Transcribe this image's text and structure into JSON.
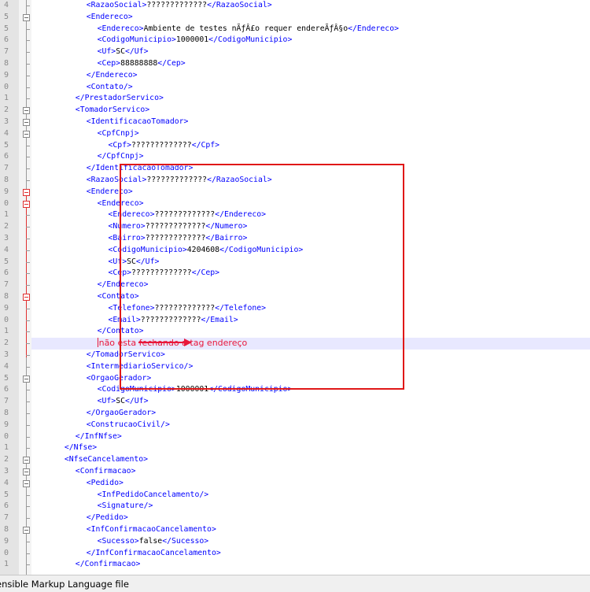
{
  "editor": {
    "line_numbers": [
      "4",
      "5",
      "5",
      "6",
      "7",
      "8",
      "9",
      "0",
      "1",
      "2",
      "3",
      "4",
      "5",
      "6",
      "7",
      "8",
      "9",
      "0",
      "1",
      "2",
      "3",
      "4",
      "5",
      "6",
      "7",
      "8",
      "9",
      "0",
      "1",
      "2",
      "3",
      "4",
      "5",
      "6",
      "7",
      "8",
      "9",
      "0",
      "1",
      "2",
      "3",
      "4",
      "5",
      "6",
      "7",
      "8",
      "9",
      "0",
      "1"
    ],
    "lines": [
      {
        "indent": 6,
        "tokens": [
          {
            "t": "<RazaoSocial>",
            "c": "t"
          },
          {
            "t": "?????????????",
            "c": "x"
          },
          {
            "t": "</RazaoSocial>",
            "c": "t"
          }
        ]
      },
      {
        "indent": 6,
        "tokens": [
          {
            "t": "<Endereco>",
            "c": "t"
          }
        ]
      },
      {
        "indent": 8,
        "tokens": [
          {
            "t": "<Endereco>",
            "c": "t"
          },
          {
            "t": "Ambiente de testes nÃƒÂ£o requer endereÃƒÂ§o",
            "c": "x"
          },
          {
            "t": "</Endereco>",
            "c": "t"
          }
        ]
      },
      {
        "indent": 8,
        "tokens": [
          {
            "t": "<CodigoMunicipio>",
            "c": "t"
          },
          {
            "t": "1000001",
            "c": "x"
          },
          {
            "t": "</CodigoMunicipio>",
            "c": "t"
          }
        ]
      },
      {
        "indent": 8,
        "tokens": [
          {
            "t": "<Uf>",
            "c": "t"
          },
          {
            "t": "SC",
            "c": "x"
          },
          {
            "t": "</Uf>",
            "c": "t"
          }
        ]
      },
      {
        "indent": 8,
        "tokens": [
          {
            "t": "<Cep>",
            "c": "t"
          },
          {
            "t": "88888888",
            "c": "x"
          },
          {
            "t": "</Cep>",
            "c": "t"
          }
        ]
      },
      {
        "indent": 6,
        "tokens": [
          {
            "t": "</Endereco>",
            "c": "t"
          }
        ]
      },
      {
        "indent": 6,
        "tokens": [
          {
            "t": "<Contato/>",
            "c": "t"
          }
        ]
      },
      {
        "indent": 4,
        "tokens": [
          {
            "t": "</PrestadorServico>",
            "c": "t"
          }
        ]
      },
      {
        "indent": 4,
        "tokens": [
          {
            "t": "<TomadorServico>",
            "c": "t"
          }
        ]
      },
      {
        "indent": 6,
        "tokens": [
          {
            "t": "<IdentificacaoTomador>",
            "c": "t"
          }
        ]
      },
      {
        "indent": 8,
        "tokens": [
          {
            "t": "<CpfCnpj>",
            "c": "t"
          }
        ]
      },
      {
        "indent": 10,
        "tokens": [
          {
            "t": "<Cpf>",
            "c": "t"
          },
          {
            "t": "?????????????",
            "c": "x"
          },
          {
            "t": "</Cpf>",
            "c": "t"
          }
        ]
      },
      {
        "indent": 8,
        "tokens": [
          {
            "t": "</CpfCnpj>",
            "c": "t"
          }
        ]
      },
      {
        "indent": 6,
        "tokens": [
          {
            "t": "</IdentificacaoTomador>",
            "c": "t"
          }
        ]
      },
      {
        "indent": 6,
        "tokens": [
          {
            "t": "<RazaoSocial>",
            "c": "t"
          },
          {
            "t": "?????????????",
            "c": "x"
          },
          {
            "t": "</RazaoSocial>",
            "c": "t"
          }
        ]
      },
      {
        "indent": 6,
        "tokens": [
          {
            "t": "<Endereco>",
            "c": "t"
          }
        ]
      },
      {
        "indent": 8,
        "tokens": [
          {
            "t": "<Endereco>",
            "c": "t"
          }
        ]
      },
      {
        "indent": 10,
        "tokens": [
          {
            "t": "<Endereco>",
            "c": "t"
          },
          {
            "t": "?????????????",
            "c": "x"
          },
          {
            "t": "</Endereco>",
            "c": "t"
          }
        ]
      },
      {
        "indent": 10,
        "tokens": [
          {
            "t": "<Numero>",
            "c": "t"
          },
          {
            "t": "?????????????",
            "c": "x"
          },
          {
            "t": "</Numero>",
            "c": "t"
          }
        ]
      },
      {
        "indent": 10,
        "tokens": [
          {
            "t": "<Bairro>",
            "c": "t"
          },
          {
            "t": "?????????????",
            "c": "x"
          },
          {
            "t": "</Bairro>",
            "c": "t"
          }
        ]
      },
      {
        "indent": 10,
        "tokens": [
          {
            "t": "<CodigoMunicipio>",
            "c": "t"
          },
          {
            "t": "4204608",
            "c": "x"
          },
          {
            "t": "</CodigoMunicipio>",
            "c": "t"
          }
        ]
      },
      {
        "indent": 10,
        "tokens": [
          {
            "t": "<Uf>",
            "c": "t"
          },
          {
            "t": "SC",
            "c": "x"
          },
          {
            "t": "</Uf>",
            "c": "t"
          }
        ]
      },
      {
        "indent": 10,
        "tokens": [
          {
            "t": "<Cep>",
            "c": "t"
          },
          {
            "t": "?????????????",
            "c": "x"
          },
          {
            "t": "</Cep>",
            "c": "t"
          }
        ]
      },
      {
        "indent": 8,
        "tokens": [
          {
            "t": "</Endereco>",
            "c": "t"
          }
        ]
      },
      {
        "indent": 8,
        "tokens": [
          {
            "t": "<Contato>",
            "c": "t"
          }
        ]
      },
      {
        "indent": 10,
        "tokens": [
          {
            "t": "<Telefone>",
            "c": "t"
          },
          {
            "t": "?????????????",
            "c": "x"
          },
          {
            "t": "</Telefone>",
            "c": "t"
          }
        ]
      },
      {
        "indent": 10,
        "tokens": [
          {
            "t": "<Email>",
            "c": "t"
          },
          {
            "t": "?????????????",
            "c": "x"
          },
          {
            "t": "</Email>",
            "c": "t"
          }
        ]
      },
      {
        "indent": 8,
        "tokens": [
          {
            "t": "</Contato>",
            "c": "t"
          }
        ]
      },
      {
        "indent": 8,
        "annotation": "não esta fechando a tag endereço",
        "highlight": true,
        "tokens": []
      },
      {
        "indent": 6,
        "tokens": [
          {
            "t": "</TomadorServico>",
            "c": "t"
          }
        ]
      },
      {
        "indent": 6,
        "tokens": [
          {
            "t": "<IntermediarioServico/>",
            "c": "t"
          }
        ]
      },
      {
        "indent": 6,
        "tokens": [
          {
            "t": "<OrgaoGerador>",
            "c": "t"
          }
        ]
      },
      {
        "indent": 8,
        "tokens": [
          {
            "t": "<CodigoMunicipio>",
            "c": "t"
          },
          {
            "t": "1000001",
            "c": "x"
          },
          {
            "t": "</CodigoMunicipio>",
            "c": "t"
          }
        ]
      },
      {
        "indent": 8,
        "tokens": [
          {
            "t": "<Uf>",
            "c": "t"
          },
          {
            "t": "SC",
            "c": "x"
          },
          {
            "t": "</Uf>",
            "c": "t"
          }
        ]
      },
      {
        "indent": 6,
        "tokens": [
          {
            "t": "</OrgaoGerador>",
            "c": "t"
          }
        ]
      },
      {
        "indent": 6,
        "tokens": [
          {
            "t": "<ConstrucaoCivil/>",
            "c": "t"
          }
        ]
      },
      {
        "indent": 4,
        "tokens": [
          {
            "t": "</InfNfse>",
            "c": "t"
          }
        ]
      },
      {
        "indent": 2,
        "tokens": [
          {
            "t": "</Nfse>",
            "c": "t"
          }
        ]
      },
      {
        "indent": 2,
        "tokens": [
          {
            "t": "<NfseCancelamento>",
            "c": "t"
          }
        ]
      },
      {
        "indent": 4,
        "tokens": [
          {
            "t": "<Confirmacao>",
            "c": "t"
          }
        ]
      },
      {
        "indent": 6,
        "tokens": [
          {
            "t": "<Pedido>",
            "c": "t"
          }
        ]
      },
      {
        "indent": 8,
        "tokens": [
          {
            "t": "<InfPedidoCancelamento/>",
            "c": "t"
          }
        ]
      },
      {
        "indent": 8,
        "tokens": [
          {
            "t": "<Signature/>",
            "c": "t"
          }
        ]
      },
      {
        "indent": 6,
        "tokens": [
          {
            "t": "</Pedido>",
            "c": "t"
          }
        ]
      },
      {
        "indent": 6,
        "tokens": [
          {
            "t": "<InfConfirmacaoCancelamento>",
            "c": "t"
          }
        ]
      },
      {
        "indent": 8,
        "tokens": [
          {
            "t": "<Sucesso>",
            "c": "t"
          },
          {
            "t": "false",
            "c": "x"
          },
          {
            "t": "</Sucesso>",
            "c": "t"
          }
        ]
      },
      {
        "indent": 6,
        "tokens": [
          {
            "t": "</InfConfirmacaoCancelamento>",
            "c": "t"
          }
        ]
      },
      {
        "indent": 4,
        "tokens": [
          {
            "t": "</Confirmacao>",
            "c": "t"
          }
        ]
      }
    ],
    "fold_boxes": [
      1,
      9,
      10,
      11,
      16,
      17,
      25,
      32,
      39,
      40,
      41,
      45
    ],
    "red_fold_boxes": [
      16,
      17,
      25
    ]
  },
  "status_bar": {
    "file_type": "ensible Markup Language file"
  },
  "colors": {
    "tag": "#0000ff",
    "text": "#000000",
    "annotation": "#e8173a",
    "highlight_row": "#e8e8ff"
  }
}
